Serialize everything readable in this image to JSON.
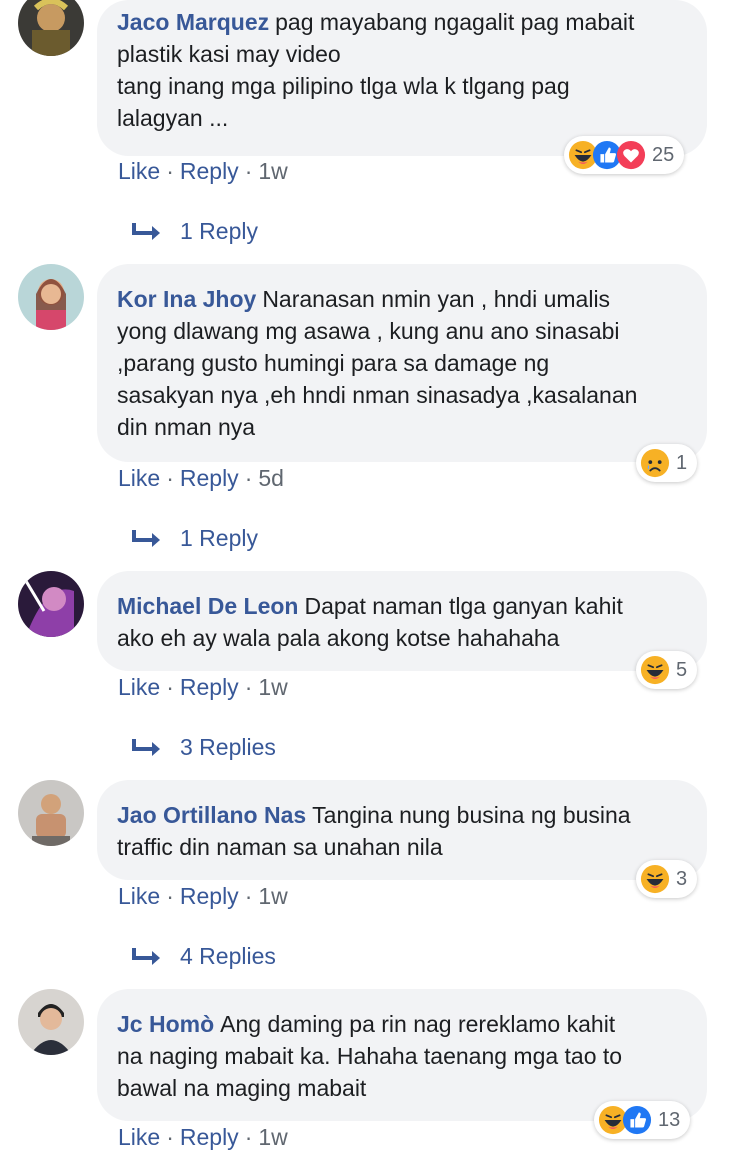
{
  "comments": [
    {
      "author": "Jaco Marquez",
      "text": "pag mayabang ngagalit pag mabait plastik kasi may video tang inang mga pilipino tlga wla k tlgang pag lalagyan ...",
      "line1": "pag mayabang ngagalit pag mabait",
      "line2": "plastik kasi may video",
      "line3": "tang inang mga pilipino tlga wla k tlgang pag",
      "line4": "lalagyan ...",
      "reactions": [
        "haha-icon",
        "like-icon",
        "love-icon"
      ],
      "reaction_count": "25",
      "like": "Like",
      "reply": "Reply",
      "time": "1w",
      "replies_label": "1 Reply"
    },
    {
      "author": "Kor Ina Jhoy",
      "line1": "Naranasan nmin yan , hndi umalis",
      "line2": "yong dlawang mg asawa , kung anu ano sinasabi",
      "line3": ",parang gusto humingi para sa damage ng",
      "line4": "sasakyan nya ,eh hndi nman sinasadya ,kasalanan",
      "line5": "din nman nya",
      "reactions": [
        "sad-icon"
      ],
      "reaction_count": "1",
      "like": "Like",
      "reply": "Reply",
      "time": "5d",
      "replies_label": "1 Reply"
    },
    {
      "author": "Michael De Leon",
      "line1": "Dapat naman tlga ganyan kahit",
      "line2": "ako eh ay wala pala akong kotse hahahaha",
      "reactions": [
        "haha-icon"
      ],
      "reaction_count": "5",
      "like": "Like",
      "reply": "Reply",
      "time": "1w",
      "replies_label": "3 Replies"
    },
    {
      "author": "Jao Ortillano Nas",
      "line1": "Tangina nung busina ng busina",
      "line2": "traffic din naman sa unahan nila",
      "reactions": [
        "haha-icon"
      ],
      "reaction_count": "3",
      "like": "Like",
      "reply": "Reply",
      "time": "1w",
      "replies_label": "4 Replies"
    },
    {
      "author": "Jc Homò",
      "line1": "Ang daming pa rin nag rereklamo kahit",
      "line2": "na naging mabait ka. Hahaha taenang mga tao to",
      "line3": "bawal na maging mabait",
      "reactions": [
        "haha-icon",
        "like-icon"
      ],
      "reaction_count": "13",
      "like": "Like",
      "reply": "Reply",
      "time": "1w"
    }
  ],
  "colors": {
    "link": "#385898",
    "bubble": "#f2f3f5",
    "meta": "#606770",
    "like_blue": "#2078f4",
    "love_red": "#f33e58",
    "haha_yellow": "#f7b125"
  }
}
